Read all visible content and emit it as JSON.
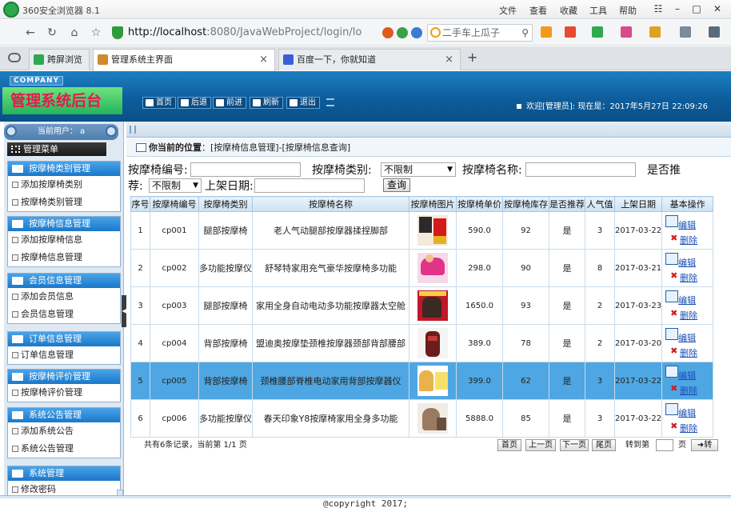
{
  "browser": {
    "title": "360安全浏览器 8.1",
    "menu": [
      "文件",
      "查看",
      "收藏",
      "工具",
      "帮助"
    ],
    "address_host": "http://localhost",
    "address_rest": ":8080/JavaWebProject/login/lo",
    "search_placeholder": "二手车上瓜子",
    "tabs": [
      {
        "label": "跨屏浏览"
      },
      {
        "label": "管理系统主界面"
      },
      {
        "label": "百度一下，你就知道"
      }
    ]
  },
  "header": {
    "company": "COMPANY",
    "title": "管理系统后台",
    "buttons": [
      "首页",
      "后退",
      "前进",
      "刷新",
      "退出"
    ],
    "welcome": "欢迎[管理员]:  现在是：2017年5月27日 22:09:26"
  },
  "sidebar": {
    "current_user": "当前用户： a",
    "main_menu": "管理菜单",
    "groups": [
      {
        "title": "按摩椅类别管理",
        "items": [
          "添加按摩椅类别",
          "按摩椅类别管理"
        ]
      },
      {
        "title": "按摩椅信息管理",
        "items": [
          "添加按摩椅信息",
          "按摩椅信息管理"
        ]
      },
      {
        "title": "会员信息管理",
        "items": [
          "添加会员信息",
          "会员信息管理"
        ]
      },
      {
        "title": "订单信息管理",
        "items": [
          "订单信息管理"
        ]
      },
      {
        "title": "按摩椅评价管理",
        "items": [
          "按摩椅评价管理"
        ]
      },
      {
        "title": "系统公告管理",
        "items": [
          "添加系统公告",
          "系统公告管理"
        ]
      },
      {
        "title": "系统管理",
        "items": [
          "修改密码"
        ]
      }
    ]
  },
  "breadcrumb": {
    "label": "你当前的位置",
    "path": "：[按摩椅信息管理]-[按摩椅信息查询]"
  },
  "filters": {
    "code_label": "按摩椅编号:",
    "type_label": "按摩椅类别:",
    "type_value": "不限制",
    "name_label": "按摩椅名称:",
    "recommend_label_a": "是否推",
    "recommend_label_b": "荐:",
    "recommend_value": "不限制",
    "date_label": "上架日期:",
    "query_button": "查询"
  },
  "table": {
    "headers": [
      "序号",
      "按摩椅编号",
      "按摩椅类别",
      "按摩椅名称",
      "按摩椅图片",
      "按摩椅单价",
      "按摩椅库存",
      "是否推荐",
      "人气值",
      "上架日期",
      "基本操作"
    ],
    "rows": [
      {
        "no": "1",
        "code": "cp001",
        "type": "腿部按摩椅",
        "name": "老人气动腿部按摩器揉捏脚部",
        "price": "590.0",
        "stock": "92",
        "recommend": "是",
        "popularity": "3",
        "date": "2017-03-22",
        "selected": false,
        "edit": "编辑",
        "del": "删除"
      },
      {
        "no": "2",
        "code": "cp002",
        "type": "多功能按摩仪",
        "name": "舒琴特家用充气豪华按摩椅多功能",
        "price": "298.0",
        "stock": "90",
        "recommend": "是",
        "popularity": "8",
        "date": "2017-03-21",
        "selected": false,
        "edit": "编辑",
        "del": "删除"
      },
      {
        "no": "3",
        "code": "cp003",
        "type": "腿部按摩椅",
        "name": "家用全身自动电动多功能按摩器太空舱",
        "price": "1650.0",
        "stock": "93",
        "recommend": "是",
        "popularity": "2",
        "date": "2017-03-23",
        "selected": false,
        "edit": "编辑",
        "del": "删除"
      },
      {
        "no": "4",
        "code": "cp004",
        "type": "背部按摩椅",
        "name": "盟迪奥按摩垫颈椎按摩器颈部背部腰部",
        "price": "389.0",
        "stock": "78",
        "recommend": "是",
        "popularity": "2",
        "date": "2017-03-20",
        "selected": false,
        "edit": "编辑",
        "del": "删除"
      },
      {
        "no": "5",
        "code": "cp005",
        "type": "背部按摩椅",
        "name": "颈椎腰部脊椎电动家用背部按摩器仪",
        "price": "399.0",
        "stock": "62",
        "recommend": "是",
        "popularity": "3",
        "date": "2017-03-22",
        "selected": true,
        "edit": "编辑",
        "del": "删除"
      },
      {
        "no": "6",
        "code": "cp006",
        "type": "多功能按摩仪",
        "name": "春天印象Y8按摩椅家用全身多功能",
        "price": "5888.0",
        "stock": "85",
        "recommend": "是",
        "popularity": "3",
        "date": "2017-03-22",
        "selected": false,
        "edit": "编辑",
        "del": "删除"
      }
    ]
  },
  "pager": {
    "info": "共有6条记录，当前第 1/1 页",
    "first": "首页",
    "prev": "上一页",
    "next": "下一页",
    "last": "尾页",
    "goto_label": "转到第",
    "page_unit": "页",
    "goto_button": "转"
  },
  "footer": {
    "copyright": "@copyright 2017;"
  }
}
